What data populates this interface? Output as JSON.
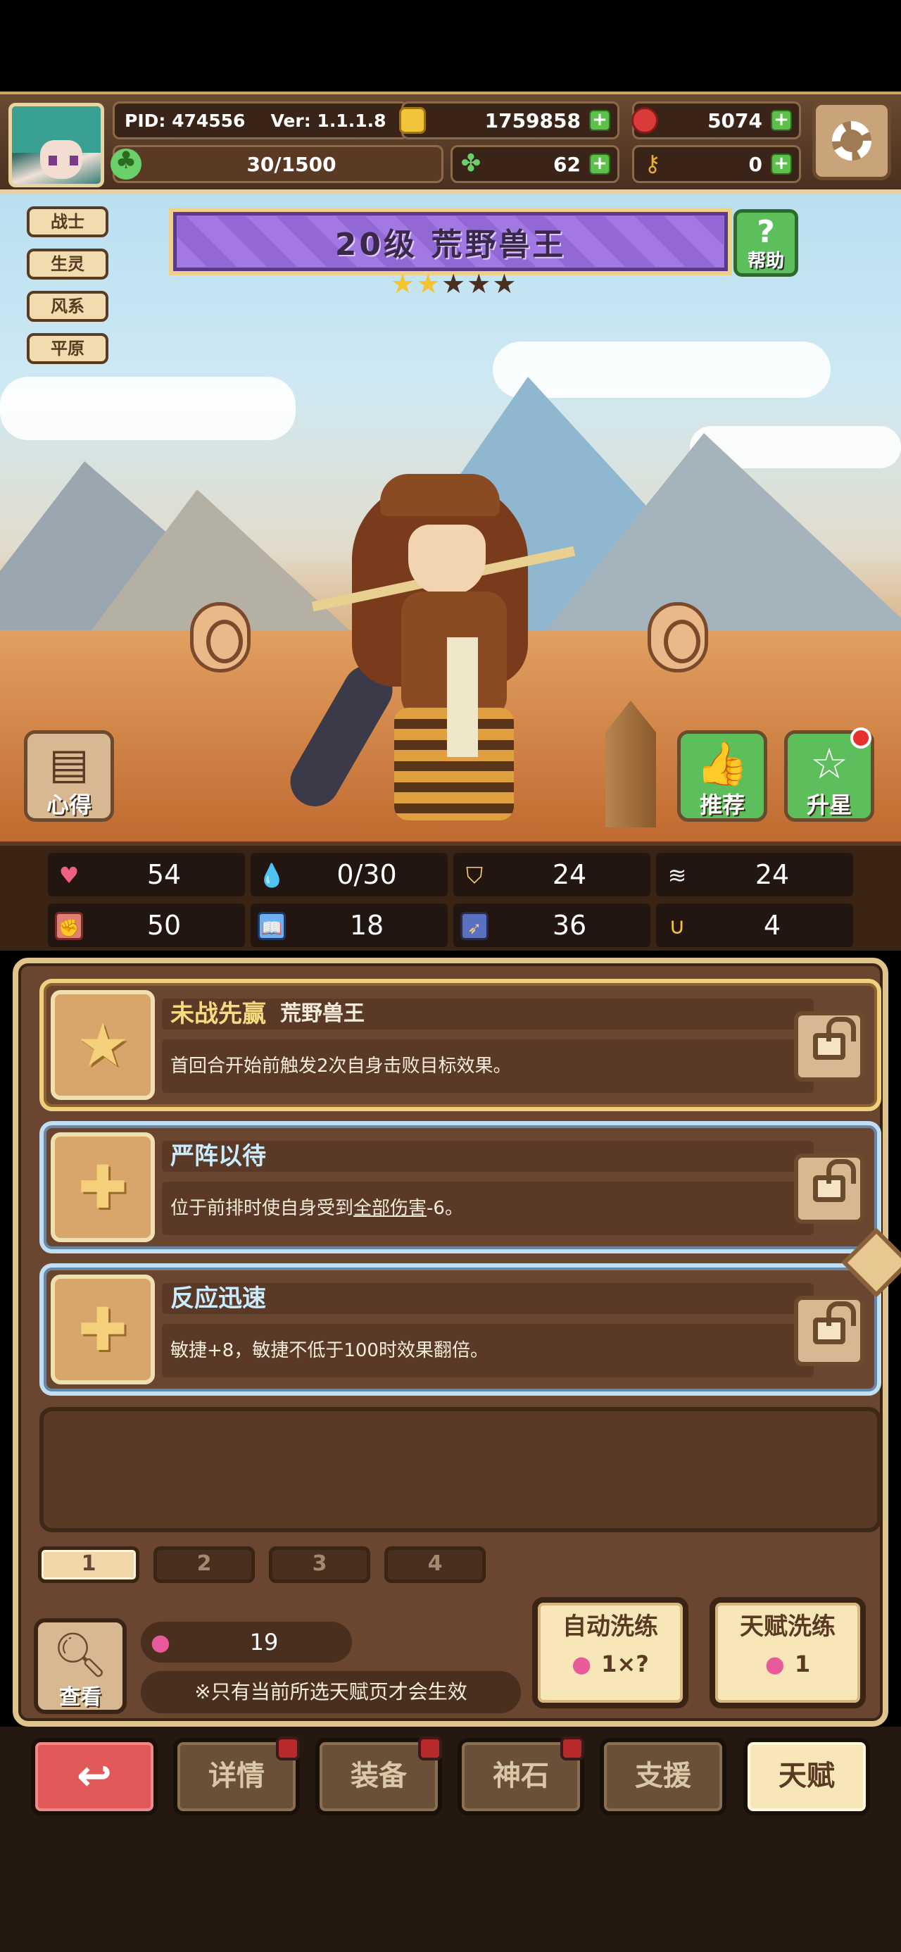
{
  "header": {
    "pid": "PID: 474556",
    "version": "Ver: 1.1.1.8",
    "gold": "1759858",
    "gems": "5074",
    "stamina": "30/1500",
    "clovers": "62",
    "keys": "0"
  },
  "character": {
    "tags": [
      "战士",
      "生灵",
      "风系",
      "平原"
    ],
    "title": "20级  荒野兽王",
    "stars_filled": 2,
    "stars_total": 5,
    "help_label": "帮助",
    "notes_label": "心得",
    "recommend_label": "推荐",
    "star_up_label": "升星"
  },
  "stats": [
    {
      "icon": "heart-icon",
      "value": "54"
    },
    {
      "icon": "mana-drop-icon",
      "value": "0/30"
    },
    {
      "icon": "shield-icon",
      "value": "24"
    },
    {
      "icon": "wing-icon",
      "value": "24"
    },
    {
      "icon": "fist-icon",
      "value": "50"
    },
    {
      "icon": "book-icon",
      "value": "18"
    },
    {
      "icon": "speed-icon",
      "value": "36"
    },
    {
      "icon": "horseshoe-icon",
      "value": "4"
    }
  ],
  "talents": [
    {
      "name": "未战先赢",
      "owner": "荒野兽王",
      "desc_parts": [
        "首回合开始前触发2次自身击败目标效果。",
        "",
        ""
      ],
      "tier": "gold",
      "icon": "star-icon"
    },
    {
      "name": "严阵以待",
      "owner": "",
      "desc_parts": [
        "位于前排时使自身受到",
        "全部伤害",
        "-6。"
      ],
      "tier": "blue",
      "icon": "cross-icon"
    },
    {
      "name": "反应迅速",
      "owner": "",
      "desc_parts": [
        "敏捷+8，敏捷不低于100时效果翻倍。",
        "",
        ""
      ],
      "tier": "blue",
      "icon": "cross-icon"
    }
  ],
  "pages": [
    "1",
    "2",
    "3",
    "4"
  ],
  "active_page": "1",
  "bottom_panel": {
    "view_label": "查看",
    "fruit_count": "19",
    "note": "※只有当前所选天赋页才会生效",
    "auto_reroll_label": "自动洗练",
    "auto_reroll_cost": "1×?",
    "talent_reroll_label": "天赋洗练",
    "talent_reroll_cost": "1"
  },
  "nav": {
    "back": "↩",
    "details": "详情",
    "equipment": "装备",
    "godstone": "神石",
    "support": "支援",
    "talent": "天赋"
  },
  "colors": {
    "gold_frame": "#f0cf7e",
    "blue_frame": "#bfe0f2",
    "title_banner": "#9a6ee0",
    "panel": "#6a4530"
  }
}
